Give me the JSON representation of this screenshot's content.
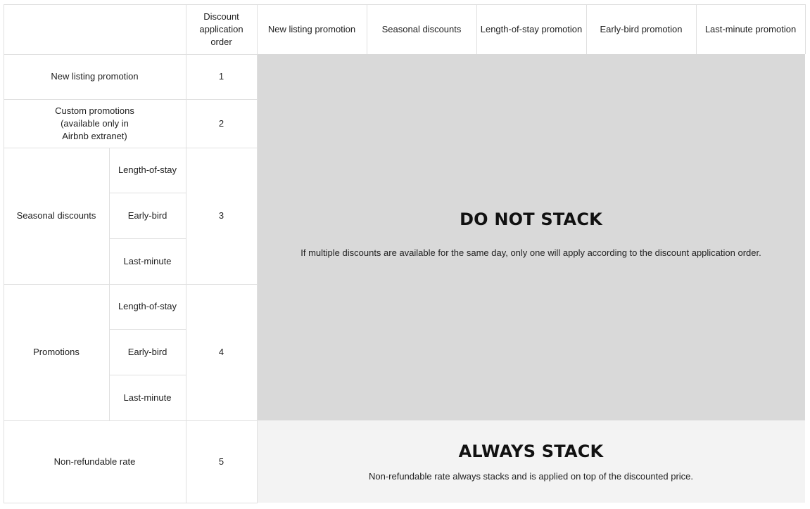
{
  "header": {
    "order_col": "Discount\napplication\norder",
    "columns": [
      "New listing promotion",
      "Seasonal discounts",
      "Length-of-stay promotion",
      "Early-bird promotion",
      "Last-minute promotion"
    ]
  },
  "rows": {
    "new_listing": {
      "label": "New listing promotion",
      "order": "1"
    },
    "custom": {
      "label": "Custom promotions\n(available only in\nAirbnb extranet)",
      "order": "2"
    },
    "seasonal": {
      "label": "Seasonal discounts",
      "order": "3",
      "sub": [
        "Length-of-stay",
        "Early-bird",
        "Last-minute"
      ]
    },
    "promotions": {
      "label": "Promotions",
      "order": "4",
      "sub": [
        "Length-of-stay",
        "Early-bird",
        "Last-minute"
      ]
    },
    "non_refundable": {
      "label": "Non-refundable rate",
      "order": "5"
    }
  },
  "do_not_stack": {
    "title": "DO NOT STACK",
    "text": "If multiple discounts are available for the same day, only one will apply according to the discount application order.",
    "background": "#d9d9d9"
  },
  "always_stack": {
    "title": "ALWAYS STACK",
    "text": "Non-refundable rate always stacks and is applied on top of the discounted price.",
    "background": "#f3f3f3"
  },
  "colors": {
    "border": "#e0e0e0",
    "text": "#222222"
  }
}
